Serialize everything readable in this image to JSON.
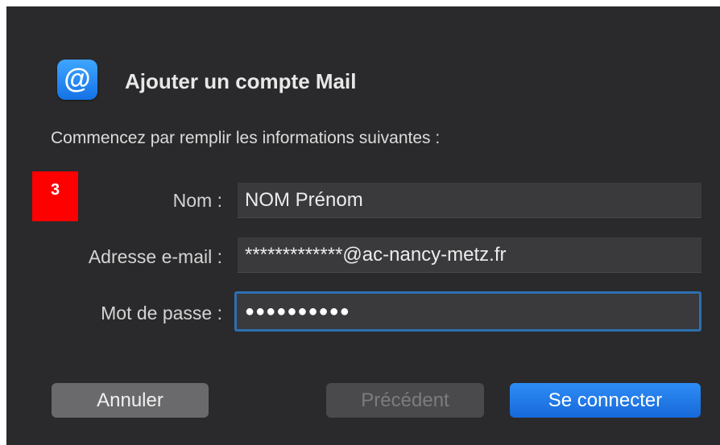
{
  "dialog": {
    "title": "Ajouter un compte Mail",
    "subtitle": "Commencez par remplir les informations suivantes :",
    "app_icon_glyph": "@",
    "step_badge": "3"
  },
  "form": {
    "name_label": "Nom :",
    "name_value": "NOM Prénom",
    "email_label": "Adresse e-mail :",
    "email_value": "*************@ac-nancy-metz.fr",
    "password_label": "Mot de passe :",
    "password_value": "●●●●●●●●●●"
  },
  "buttons": {
    "cancel_label": "Annuler",
    "previous_label": "Précédent",
    "connect_label": "Se connecter"
  },
  "colors": {
    "background": "#2a2a2c",
    "accent": "#1a73e8",
    "badge": "#ff0000",
    "focus_ring": "#2d6fb0"
  }
}
